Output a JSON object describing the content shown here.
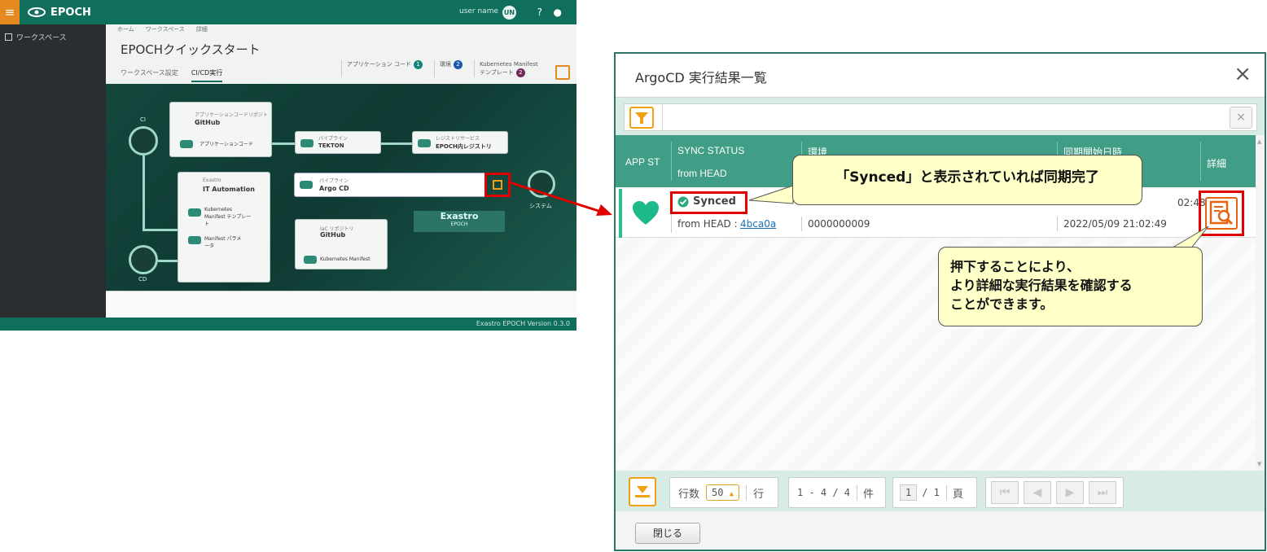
{
  "app": {
    "logo_text": "EPOCH",
    "user_name": "user name",
    "avatar_initials": "UN",
    "sidebar_item": "ワークスペース",
    "breadcrumb": [
      "ホーム",
      "ワークスペース",
      "詳細"
    ],
    "page_title": "EPOCHクイックスタート",
    "tabs": [
      "ワークスペース設定",
      "CI/CD実行"
    ],
    "active_tab": "CI/CD実行",
    "counters": [
      {
        "label": "アプリケーション コード",
        "count": "1",
        "color": "#11867a"
      },
      {
        "label": "環境",
        "count": "2",
        "color": "#1a57a8"
      },
      {
        "label": "Kubernetes Manifest テンプレート",
        "count": "2",
        "color": "#702a5a"
      }
    ],
    "diagram": {
      "ci_label": "CI",
      "cd_label": "CD",
      "system_label": "システム",
      "github_repo_caption": "アプリケーションコードリポジトリ",
      "github_name": "GitHub",
      "app_code": "アプリケーションコード",
      "pipeline_caption": "パイプライン",
      "tekton_name": "TEKTON",
      "registry_caption": "レジストリサービス",
      "registry_name": "EPOCH内レジストリ",
      "argocd_name": "Argo CD",
      "ita_caption": "Exastro",
      "ita_name": "IT Automation",
      "k8s_template": "Kubernetes Manifest テンプレート",
      "manifest_param": "Manifest パラメータ",
      "iac_caption": "IaC リポジトリ",
      "iac_name": "GitHub",
      "iac_manifest": "Kubernetes Manifest",
      "exastro_brand": "Exastro",
      "exastro_sub": "EPOCH"
    },
    "footer": "Exastro EPOCH Version 0.3.0"
  },
  "dialog": {
    "title": "ArgoCD 実行結果一覧",
    "close_icon": "×",
    "filter_clear": "×",
    "columns": {
      "app_status": "APP ST",
      "sync_status": "SYNC STATUS",
      "from_head": "from HEAD",
      "environment": "環境",
      "sync_start": "同期開始日時",
      "detail": "詳細"
    },
    "row": {
      "sync_status": "Synced",
      "from_head_label": "from HEAD :",
      "from_head_link": "4bca0a",
      "env_id": "0000000009",
      "sync_start_time_top": "02:48",
      "sync_start_time": "2022/05/09 21:02:49"
    },
    "pager": {
      "rows_label": "行数",
      "rows_value": "50",
      "rows_unit": "行",
      "range": "1 - 4 / 4",
      "count_unit": "件",
      "page_current": "1",
      "page_total": "/ 1",
      "page_unit": "頁"
    },
    "close_button": "閉じる"
  },
  "callouts": {
    "synced_note": "「Synced」と表示されていれば同期完了",
    "detail_note_line1": "押下することにより、",
    "detail_note_line2": "より詳細な実行結果を確認する",
    "detail_note_line3": "ことができます。"
  }
}
